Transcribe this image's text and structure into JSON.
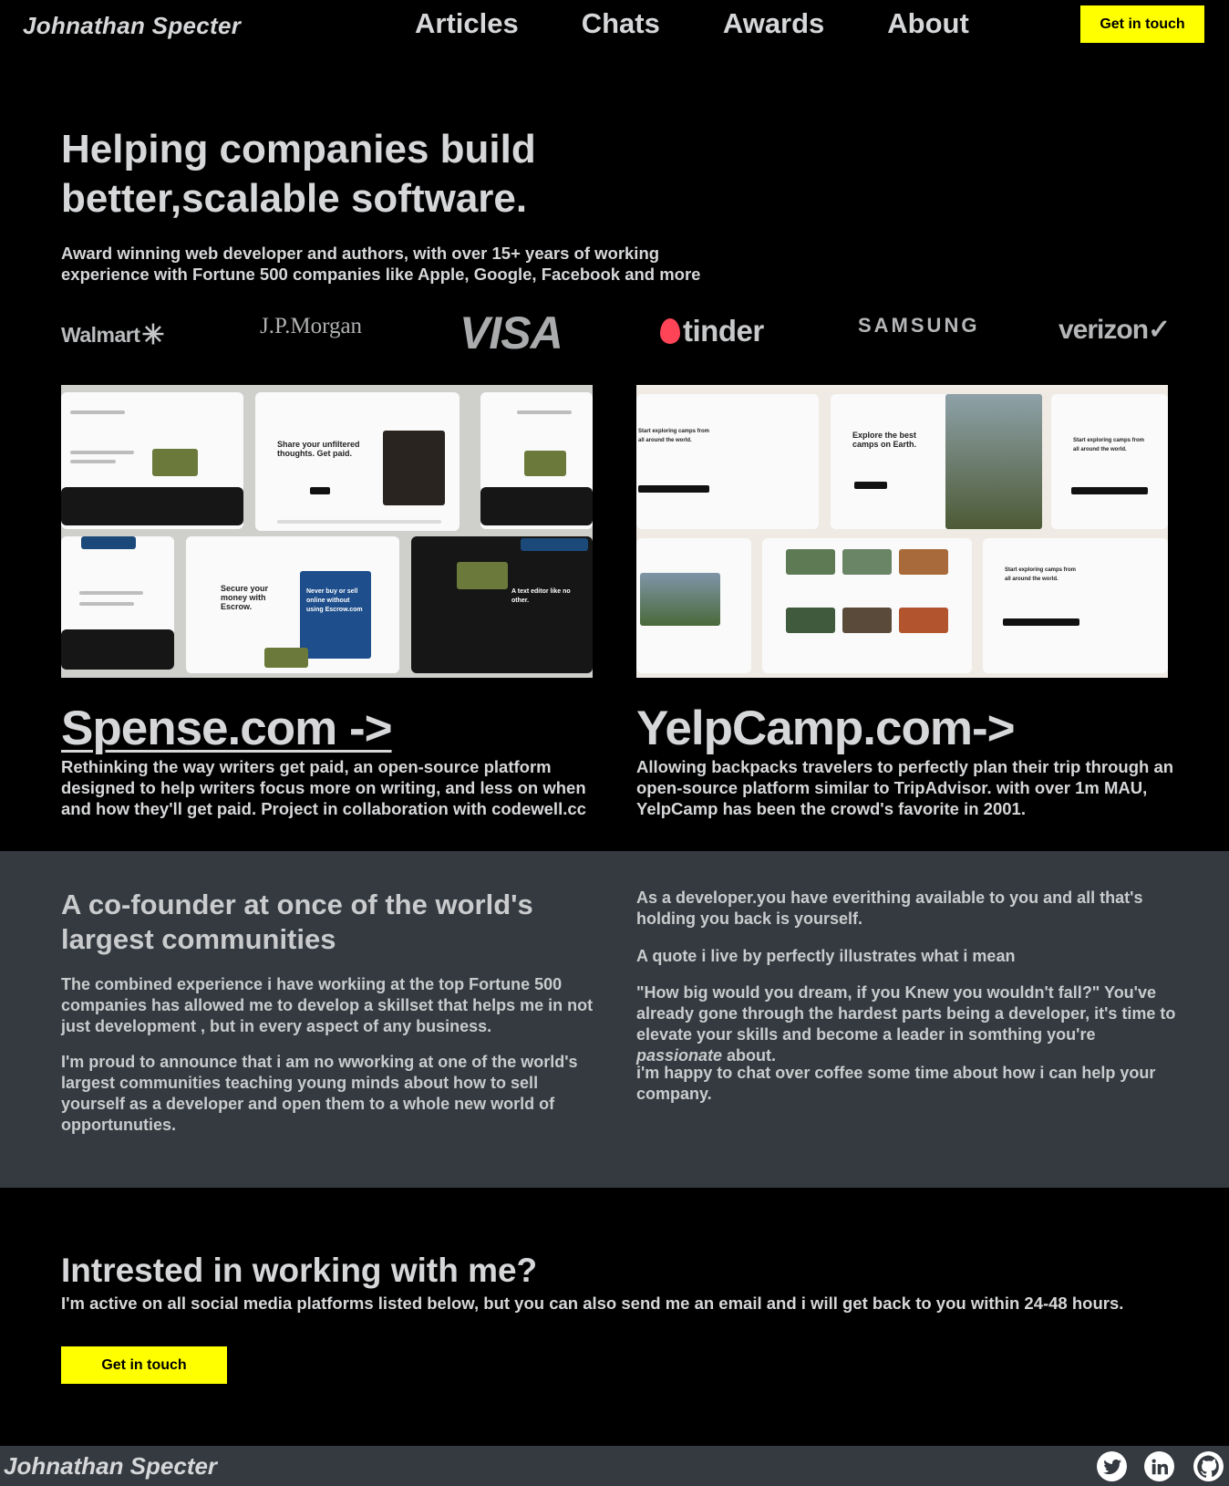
{
  "header": {
    "brand": "Johnathan Specter",
    "nav": [
      "Articles",
      "Chats",
      "Awards",
      "About"
    ],
    "cta": "Get in touch"
  },
  "hero": {
    "title": "Helping companies build better,scalable software.",
    "subtitle": "Award winning web developer and authors, with over 15+ years of working experience with Fortune 500 companies like Apple, Google, Facebook and more"
  },
  "logos": {
    "walmart": "Walmart",
    "jpmorgan": "J.P.Morgan",
    "visa": "VISA",
    "tinder": "tinder",
    "samsung": "SAMSUNG",
    "verizon": "verizon"
  },
  "projects": [
    {
      "title": "Spense.com ->",
      "description": "Rethinking the way writers get paid, an open-source platform designed to help writers focus more on writing, and less on when and how they'll get paid. Project in collaboration with codewell.cc",
      "mock_headlines": [
        "Share your unfiltered thoughts. Get paid.",
        "Secure your money with Escrow.",
        "Never buy or sell online without using Escrow.com",
        "A text editor like no other."
      ]
    },
    {
      "title": "YelpCamp.com->",
      "description": "Allowing backpacks travelers to perfectly plan their trip through an open-source platform similar to TripAdvisor. with over 1m MAU, YelpCamp has been the crowd's favorite in 2001.",
      "mock_headlines": [
        "Explore the best camps on Earth.",
        "Start exploring camps from all around the world.",
        "Start exploring camps from all around the world."
      ]
    }
  ],
  "about": {
    "title": "A co-founder at once of the world's largest communities",
    "p1": "The combined experience i have workiing at the top Fortune 500 companies has allowed me to develop a skillset that helps me in not just development , but in every aspect of any business.",
    "p2": "I'm proud to announce that i am no wworking at one of the world's largest communities teaching young minds about how to sell yourself as a developer and open them to a whole new world of opportunuties.",
    "p3": "As a developer.you have everithing available to you and all that's holding you back is yourself.",
    "p4": "A quote i live by perfectly illustrates what i mean",
    "p5_before": "\"How big would you dream, if you Knew you wouldn't fall?\" You've already gone through the hardest parts being a developer, it's time to elevate your skills and become a leader in somthing you're ",
    "p5_em": "passionate",
    "p5_after": " about.",
    "p6": "i'm happy to chat over coffee some time about how i can help your company."
  },
  "contact": {
    "title": "Intrested in working with me?",
    "subtitle": "I'm active on all social media platforms listed below, but you can also send me an email and i will get back to you within 24-48 hours.",
    "cta": "Get in touch"
  },
  "footer": {
    "brand": "Johnathan Specter",
    "social": [
      "twitter-icon",
      "linkedin-icon",
      "github-icon"
    ]
  },
  "colors": {
    "background": "#000000",
    "accent": "#ffff00",
    "section_gray": "#343a40",
    "text": "#d6d7d9"
  }
}
